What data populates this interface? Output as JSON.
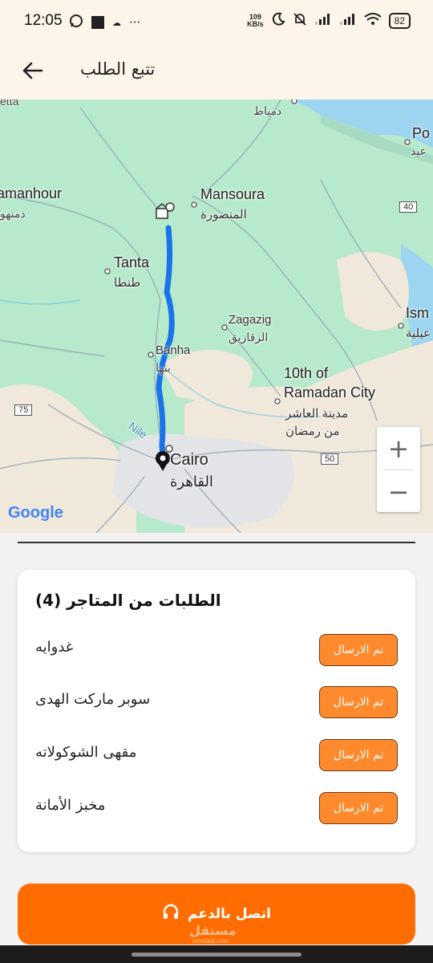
{
  "status_bar": {
    "time": "12:05",
    "net_speed": "109",
    "net_unit": "KB/s",
    "battery": "82",
    "more": "···"
  },
  "app_bar": {
    "title": "تتبع الطلب"
  },
  "map": {
    "labels": {
      "damietta": "دمياط",
      "port_said_ar": "عيد",
      "port_said": "Po",
      "damanhour": "amanhour",
      "damanhour_ar": "دمنهو",
      "mansoura": "Mansoura",
      "mansoura_ar": "المنصورة",
      "tanta": "Tanta",
      "tanta_ar": "طنطا",
      "zagazig": "Zagazig",
      "zagazig_ar": "الزقازيق",
      "banha": "Banha",
      "banha_ar": "بنها",
      "tenth_1": "10th of",
      "tenth_2": "Ramadan City",
      "tenth_ar_1": "مدينة العاشر",
      "tenth_ar_2": "من رمضان",
      "ismailia": "Ism",
      "ismailia_ar": "عيلية",
      "cairo": "Cairo",
      "cairo_ar": "القاهرة",
      "nile": "Nile",
      "top_left": "etta",
      "road_40": "40",
      "road_75": "75",
      "road_50": "50"
    },
    "google": "Google",
    "zoom_in": "+",
    "zoom_out": "−",
    "colors": {
      "route": "#1a73e8",
      "land": "#b7e9cc",
      "sea": "#9dd5f0"
    }
  },
  "orders": {
    "title": "الطلبات من المتاجر (4)",
    "items": [
      {
        "name": "غدوايه",
        "status": "تم الارسال"
      },
      {
        "name": "سوبر ماركت الهدى",
        "status": "تم الارسال"
      },
      {
        "name": "مقهى الشوكولاته",
        "status": "تم الارسال"
      },
      {
        "name": "مخبز الأمانة",
        "status": "تم الارسال"
      }
    ],
    "status_color": "#ff8a2e"
  },
  "support": {
    "label": "اتصل بالدعم",
    "icon": "headset-icon",
    "color": "#ff6d00"
  },
  "watermark": {
    "text": "مستقل",
    "sub": "mostaql.com"
  }
}
